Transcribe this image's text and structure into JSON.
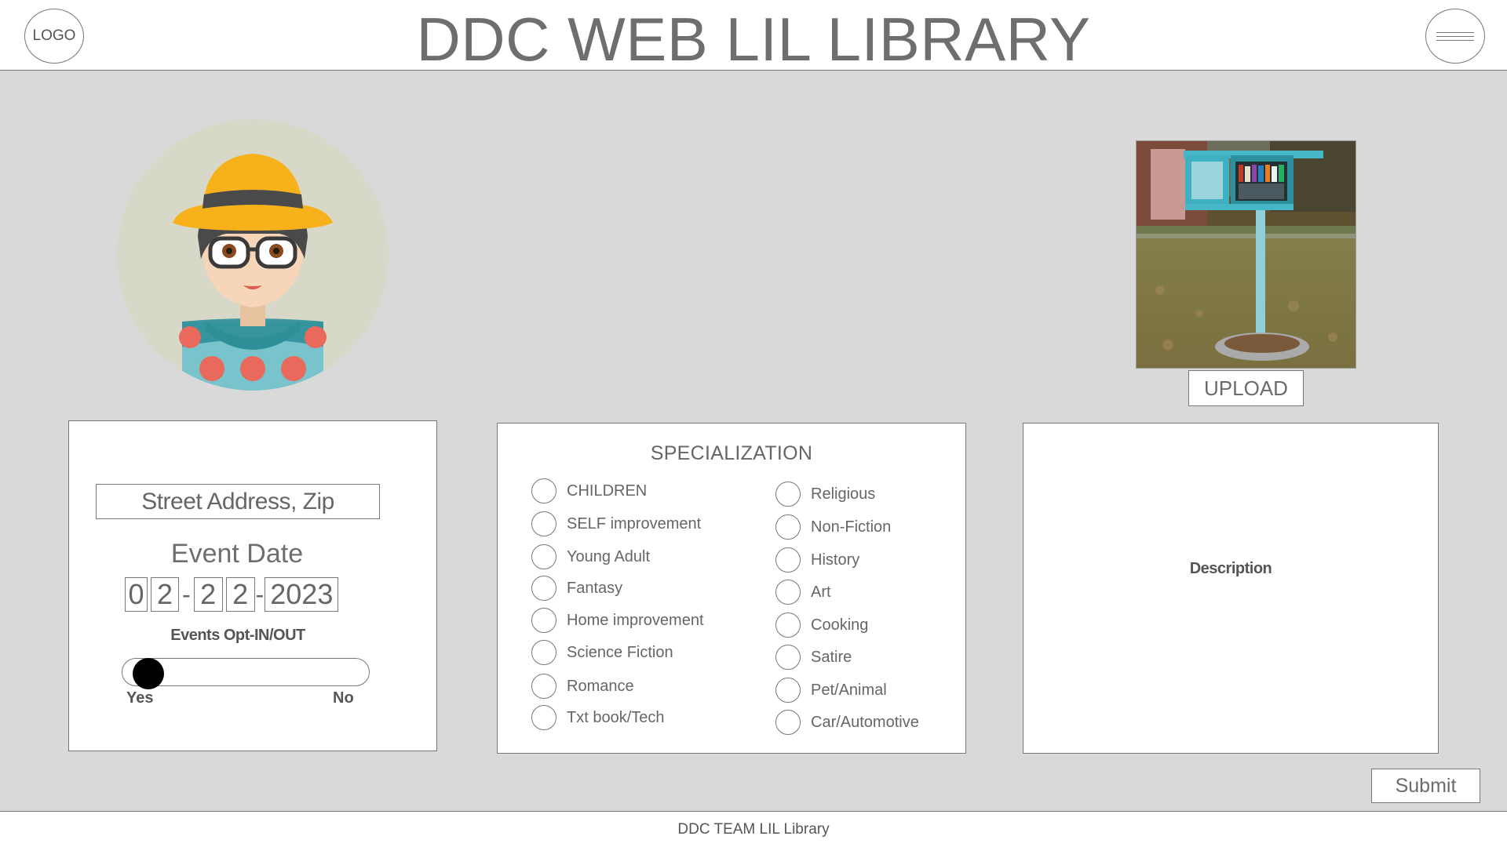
{
  "header": {
    "logo_label": "LOGO",
    "title": "DDC WEB LIL LIBRARY"
  },
  "upload": {
    "label": "UPLOAD"
  },
  "event_panel": {
    "address_placeholder": "Street Address, Zip",
    "event_date_label": "Event Date",
    "date": {
      "m1": "0",
      "m2": "2",
      "d1": "2",
      "d2": "2",
      "year": "2023",
      "sep1": "-",
      "sep2": "-"
    },
    "opt_label": "Events Opt-IN/OUT",
    "toggle_yes": "Yes",
    "toggle_no": "No",
    "toggle_state": "Yes"
  },
  "specialization": {
    "title": "SPECIALIZATION",
    "left": [
      "CHILDREN",
      "SELF improvement",
      "Young Adult",
      "Fantasy",
      "Home improvement",
      "Science Fiction",
      "Romance",
      "Txt book/Tech"
    ],
    "right": [
      "Religious",
      "Non-Fiction",
      "History",
      "Art",
      "Cooking",
      "Satire",
      "Pet/Animal",
      "Car/Automotive"
    ]
  },
  "description": {
    "label": "Description"
  },
  "submit": {
    "label": "Submit"
  },
  "footer": {
    "text": "DDC TEAM LIL Library"
  },
  "colors": {
    "background": "#d9d9d9",
    "hat": "#f7b21b",
    "shirt": "#78c3cc",
    "dots": "#e96a5c"
  }
}
